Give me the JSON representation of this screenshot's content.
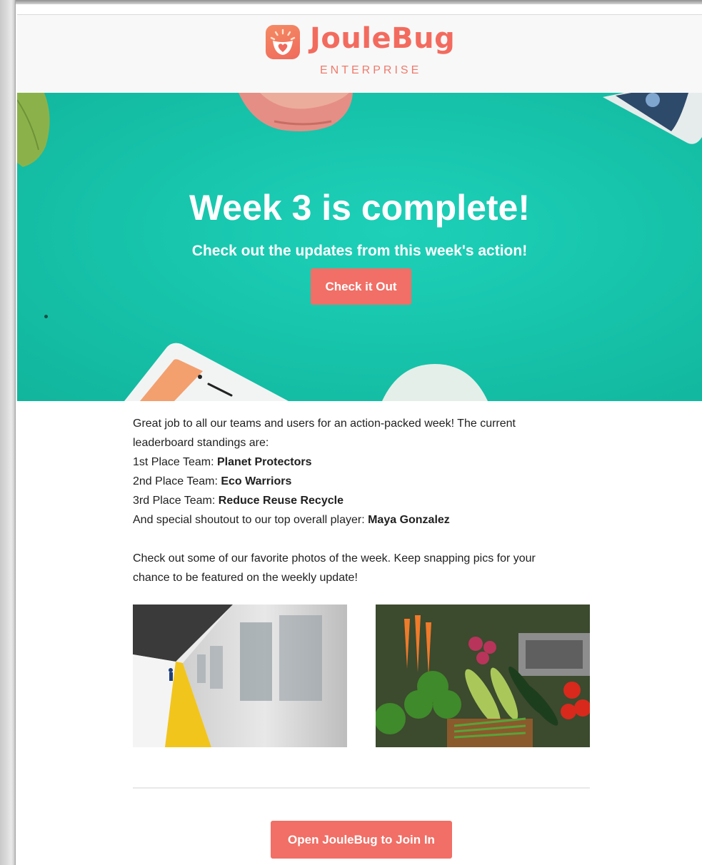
{
  "header": {
    "logo_word": "JouleBug",
    "logo_sub": "ENTERPRISE"
  },
  "hero": {
    "title": "Week 3 is complete!",
    "subtitle": "Check out the updates from this week's action!",
    "button_label": "Check it Out"
  },
  "content": {
    "intro_line1": "Great job to all our teams and users for an action-packed week! The current",
    "intro_line2": "leaderboard standings are:",
    "standings": [
      {
        "label": "1st Place Team: ",
        "team": "Planet Protectors"
      },
      {
        "label": "2nd Place Team: ",
        "team": "Eco Warriors"
      },
      {
        "label": "3rd Place Team: ",
        "team": "Reduce Reuse Recycle"
      }
    ],
    "shoutout_label": "And special shoutout to our top overall player: ",
    "shoutout_name": "Maya Gonzalez",
    "photos_line1": "Check out some of our favorite photos of the week. Keep snapping pics for your",
    "photos_line2": "chance to be featured on the weekly update!"
  },
  "footer": {
    "button_label": "Open JouleBug to Join In"
  },
  "colors": {
    "brand": "#f36b5e",
    "button": "#f16f66",
    "hero_bg": "#17c5ac"
  },
  "icons": {
    "logo": "lightbulb-heart-icon"
  }
}
